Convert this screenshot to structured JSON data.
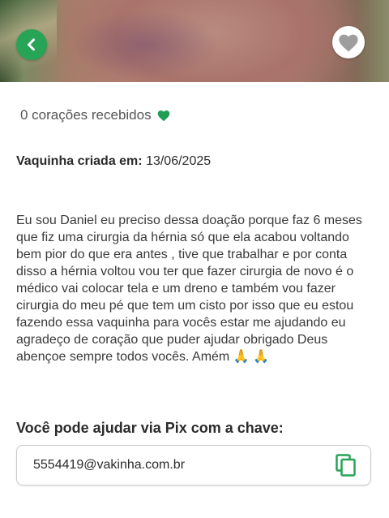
{
  "hearts": {
    "text": "0 corações recebidos"
  },
  "created": {
    "label": "Vaquinha criada em:",
    "date": "13/06/2025"
  },
  "story": {
    "text": "Eu sou Daniel eu preciso dessa doação porque faz 6 meses que fiz uma cirurgia da hérnia só que ela acabou voltando bem pior do que era antes , tive que trabalhar e por conta disso a hérnia voltou vou ter que fazer cirurgia de novo é o médico vai colocar tela e um dreno e também vou fazer cirurgia do meu pé que tem um cisto por isso que eu estou fazendo essa vaquinha para vocês estar me ajudando eu agradeço de coração que puder ajudar obrigado Deus abençoe sempre todos vocês. Amém 🙏 🙏"
  },
  "pix": {
    "title": "Você pode ajudar via Pix com a chave:",
    "key": "5554419@vakinha.com.br"
  },
  "icons": {
    "back": "arrow-left-icon",
    "favorite": "heart-icon",
    "hearts_count": "heart-icon",
    "copy": "copy-icon"
  },
  "colors": {
    "accent": "#27a456",
    "heart_green": "#1f9d55",
    "favorite_gray": "#9e9e9e"
  }
}
